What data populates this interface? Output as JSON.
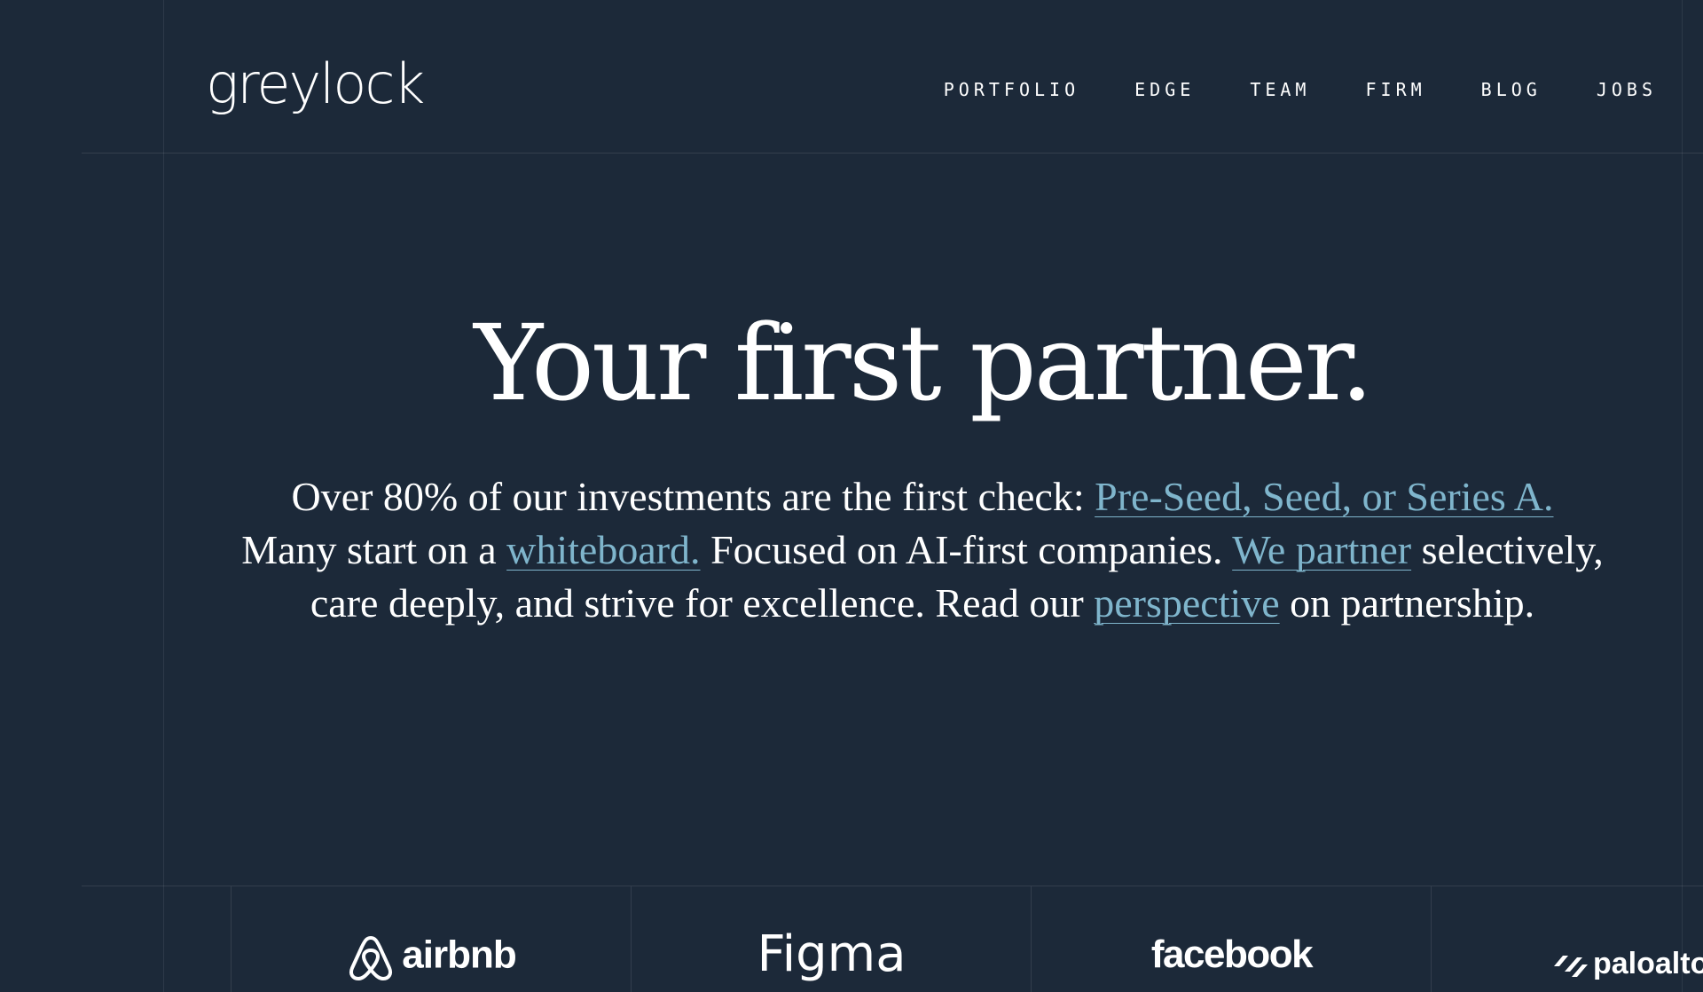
{
  "header": {
    "logo": "greylock",
    "nav": [
      "PORTFOLIO",
      "EDGE",
      "TEAM",
      "FIRM",
      "BLOG",
      "JOBS"
    ]
  },
  "hero": {
    "title": "Your first partner.",
    "text_1": "Over 80% of our investments are the first check: ",
    "link_stages": "Pre-Seed, Seed, or Series A.",
    "text_2": " Many start on a ",
    "link_whiteboard": "whiteboard.",
    "text_3": " Focused on AI-first companies. ",
    "link_partner": "We partner",
    "text_4": " selectively, care deeply, and strive for excellence. Read our ",
    "link_perspective": "perspective",
    "text_5": " on partnership."
  },
  "portfolio_logos": [
    "airbnb",
    "Figma",
    "facebook",
    "paloalto"
  ],
  "icons": [
    "airbnb-logo-icon",
    "paloalto-logo-icon"
  ],
  "colors": {
    "background": "#1c2939",
    "link": "#7fb5cc",
    "text": "#ffffff"
  }
}
